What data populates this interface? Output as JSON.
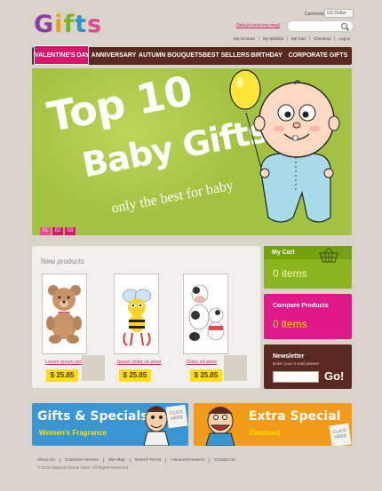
{
  "header": {
    "logo_letters": [
      "G",
      "i",
      "f",
      "t",
      "s"
    ],
    "currency_label": "Currencies:",
    "currency_value": "US Dollar",
    "welcome_msg": "Default welcome msg!",
    "top_links": [
      "My Account",
      "My Wishlist",
      "My Cart",
      "Checkout",
      "Log In"
    ]
  },
  "nav": {
    "items": [
      "VALENTINE'S DAY",
      "ANNIVERSARY",
      "AUTUMN BOUQUETS",
      "BEST SELLERS",
      "BIRTHDAY",
      "CORPORATE GIFTS"
    ],
    "active_index": 0
  },
  "banner": {
    "title_line1": "Top 10",
    "title_line2": "Baby Gifts",
    "subtitle": "only the best for baby",
    "pages": [
      "01",
      "02",
      "03"
    ],
    "active_page": 0
  },
  "products": {
    "title": "New products",
    "items": [
      {
        "name": "Lorem ipsum dolor sit amet",
        "price": "$ 25.85"
      },
      {
        "name": "Ipsum dolor sit amet",
        "price": "$ 25.85"
      },
      {
        "name": "Dolor sit amet",
        "price": "$ 25.85"
      }
    ]
  },
  "sidebar": {
    "cart": {
      "title": "My Cart",
      "value": "0 items"
    },
    "compare": {
      "title": "Compare Products",
      "value": "0 items"
    },
    "newsletter": {
      "title": "Newsletter",
      "subtitle": "Enter your e-mail please",
      "go": "Go!"
    }
  },
  "promos": [
    {
      "title": "Gifts & Specials",
      "subtitle": "Women's Fragrance",
      "badge": "CLICK HERE"
    },
    {
      "title": "Extra Special",
      "subtitle": "Discount",
      "badge": "CLICK HERE"
    }
  ],
  "footer": {
    "links": [
      "About Us",
      "Customer Service",
      "Site Map",
      "Search Terms",
      "Advanced Search",
      "Contact Us"
    ],
    "copyright": "© 2011 Magento Demo Store. All Rights Reserved."
  },
  "colors": {
    "brand_pink": "#d8166f",
    "nav_brown": "#5a2a20",
    "banner_green": "#a2c241",
    "cart_green": "#8ab51c",
    "compare_magenta": "#e0188a",
    "price_yellow": "#ffe000",
    "promo_blue": "#3a96d3",
    "promo_orange": "#f29b1a"
  },
  "icons": [
    "search-icon",
    "basket-icon",
    "baby-illustration",
    "teddy-bear-image",
    "bee-toy-image",
    "cow-toys-image",
    "cartoon-man-illustration"
  ]
}
